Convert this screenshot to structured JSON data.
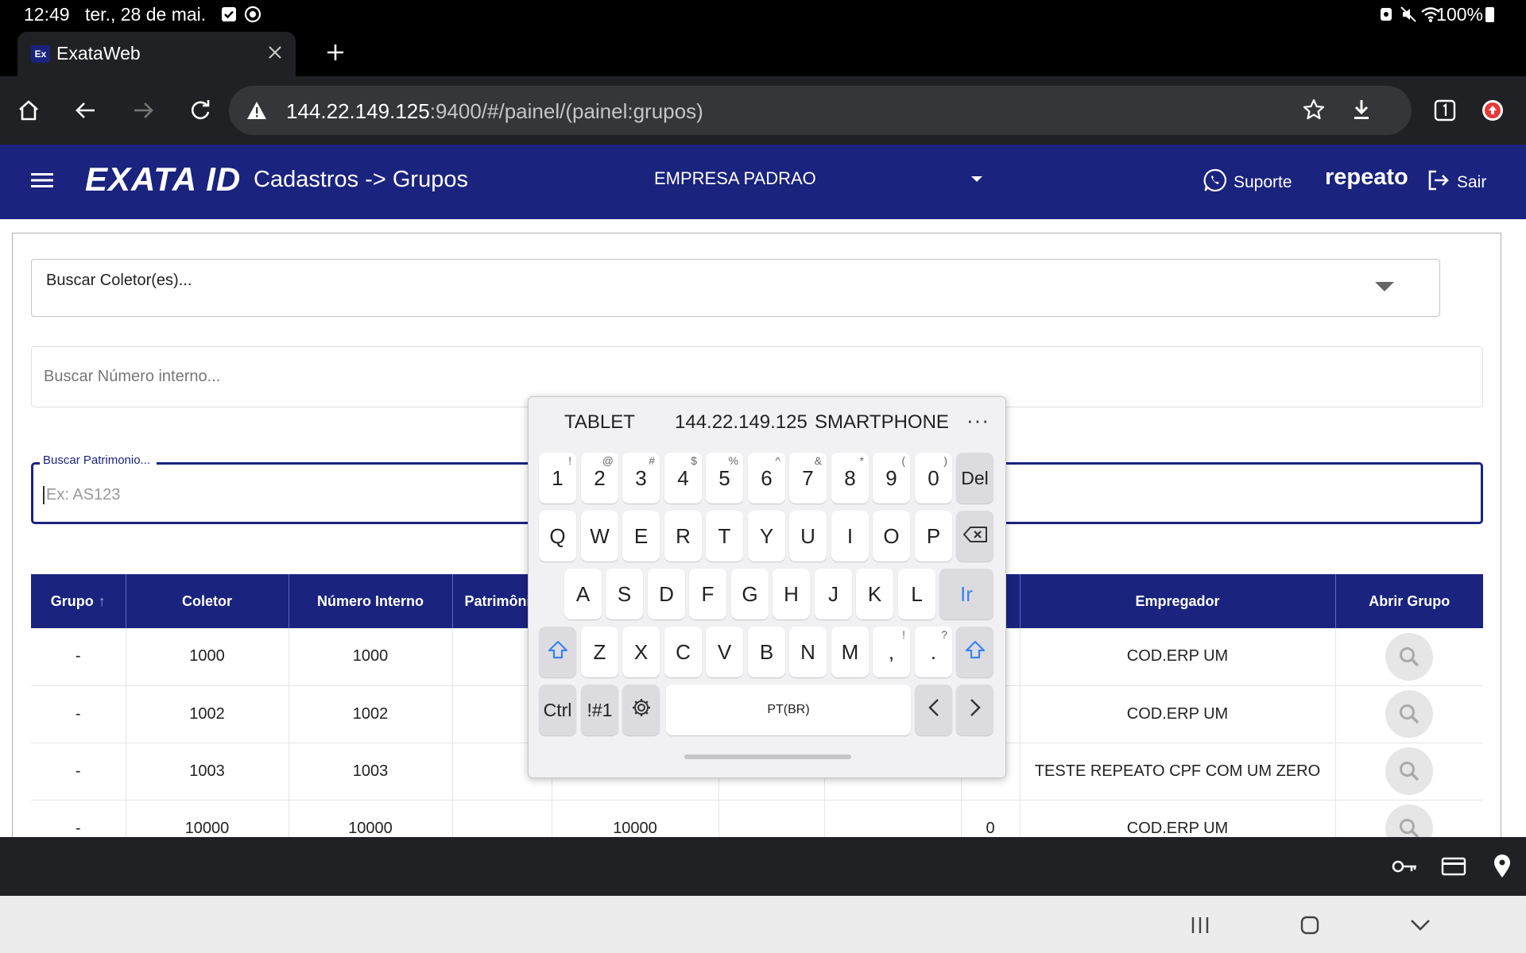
{
  "status_bar": {
    "time": "12:49",
    "date": "ter., 28 de mai.",
    "battery": "100%"
  },
  "browser": {
    "tab": {
      "favicon_text": "Ex",
      "title": "ExataWeb"
    },
    "url_host": "144.22.149.125",
    "url_path": ":9400/#/painel/(painel:grupos)"
  },
  "app": {
    "logo": "EXATA ID",
    "page_title": "Cadastros -> Grupos",
    "company": "EMPRESA PADRAO",
    "support_label": "Suporte",
    "username": "repeato",
    "logout_label": "Sair",
    "brand_color": "#1a237e"
  },
  "filters": {
    "collector_placeholder": "Buscar Coletor(es)...",
    "internal_number_placeholder": "Buscar Número interno...",
    "patrimony_label": "Buscar Patrimonio...",
    "patrimony_placeholder": "Ex: AS123"
  },
  "table": {
    "headers": {
      "grupo": "Grupo",
      "coletor": "Coletor",
      "numero_interno": "Número Interno",
      "patrimonio": "Patrimônio",
      "empregador": "Empregador",
      "abrir_grupo": "Abrir Grupo"
    },
    "rows": [
      {
        "grupo": "-",
        "coletor": "1000",
        "numero_interno": "1000",
        "c4": "",
        "c5": "",
        "c6": "",
        "c7": "",
        "c8": "",
        "empregador": "COD.ERP UM"
      },
      {
        "grupo": "-",
        "coletor": "1002",
        "numero_interno": "1002",
        "c4": "",
        "c5": "",
        "c6": "",
        "c7": "",
        "c8": "",
        "empregador": "COD.ERP UM"
      },
      {
        "grupo": "-",
        "coletor": "1003",
        "numero_interno": "1003",
        "c4": "",
        "c5": "",
        "c6": "",
        "c7": "",
        "c8": "",
        "empregador": "TESTE REPEATO CPF COM UM ZERO"
      },
      {
        "grupo": "-",
        "coletor": "10000",
        "numero_interno": "10000",
        "c4": "",
        "c5": "10000",
        "c6": "",
        "c7": "",
        "c8": "0",
        "empregador": "COD.ERP UM"
      }
    ]
  },
  "keyboard": {
    "suggestions": [
      "TABLET",
      "144.22.149.125",
      "SMARTPHONE"
    ],
    "more": "···",
    "row1": [
      {
        "k": "1",
        "s": "!"
      },
      {
        "k": "2",
        "s": "@"
      },
      {
        "k": "3",
        "s": "#"
      },
      {
        "k": "4",
        "s": "$"
      },
      {
        "k": "5",
        "s": "%"
      },
      {
        "k": "6",
        "s": "^"
      },
      {
        "k": "7",
        "s": "&"
      },
      {
        "k": "8",
        "s": "*"
      },
      {
        "k": "9",
        "s": "("
      },
      {
        "k": "0",
        "s": ")"
      }
    ],
    "del": "Del",
    "row2": [
      "Q",
      "W",
      "E",
      "R",
      "T",
      "Y",
      "U",
      "I",
      "O",
      "P"
    ],
    "row3": [
      "A",
      "S",
      "D",
      "F",
      "G",
      "H",
      "J",
      "K",
      "L"
    ],
    "go": "Ir",
    "row4": [
      "Z",
      "X",
      "C",
      "V",
      "B",
      "N",
      "M"
    ],
    "comma": {
      "k": ",",
      "s": "!"
    },
    "period": {
      "k": ".",
      "s": "?"
    },
    "ctrl": "Ctrl",
    "symbols": "!#1",
    "space": "PT(BR)"
  }
}
